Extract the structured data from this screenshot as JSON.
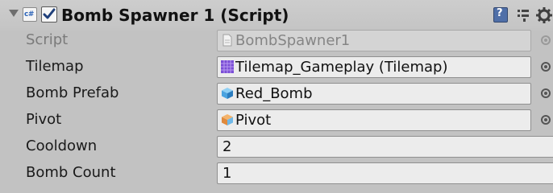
{
  "component": {
    "title": "Bomb Spawner 1 (Script)",
    "enabled": true,
    "icon": "csharp-script-icon"
  },
  "fields": {
    "script": {
      "label": "Script",
      "value": "BombSpawner1",
      "icon": "script-file-icon"
    },
    "tilemap": {
      "label": "Tilemap",
      "value": "Tilemap_Gameplay (Tilemap)",
      "icon": "tilemap-grid-icon"
    },
    "bomb_prefab": {
      "label": "Bomb Prefab",
      "value": "Red_Bomb",
      "icon": "prefab-cube-icon"
    },
    "pivot": {
      "label": "Pivot",
      "value": "Pivot",
      "icon": "gameobject-cube-icon"
    },
    "cooldown": {
      "label": "Cooldown",
      "value": "2"
    },
    "bomb_count": {
      "label": "Bomb Count",
      "value": "1"
    }
  },
  "colors": {
    "panel_bg": "#c2c2c2",
    "field_bg": "#ececec",
    "tilemap_icon": "#7b4fd6",
    "prefab_icon": "#4aa3e0",
    "gameobject_icon": "#e08a3c"
  }
}
